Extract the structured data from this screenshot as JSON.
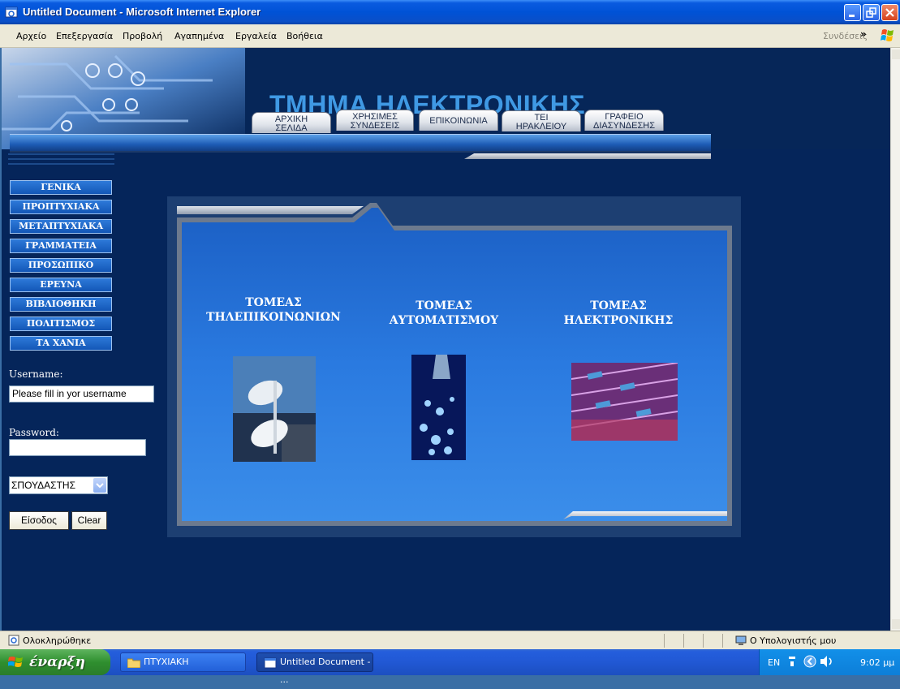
{
  "window": {
    "title": "Untitled Document - Microsoft Internet Explorer"
  },
  "menubar": {
    "items": [
      "Αρχείο",
      "Επεξεργασία",
      "Προβολή",
      "Αγαπημένα",
      "Εργαλεία",
      "Βοήθεια"
    ],
    "links_label": "Συνδέσεις"
  },
  "site": {
    "title": "ΤΜΗΜΑ ΗΛΕΚΤΡΟΝΙΚΗΣ",
    "nav_tabs": [
      {
        "line1": "ΑΡΧΙΚΗ",
        "line2": "ΣΕΛΙΔΑ"
      },
      {
        "line1": "ΧΡΗΣΙΜΕΣ",
        "line2": "ΣΥΝΔΕΣΕΙΣ"
      },
      {
        "line1": "ΕΠΙΚΟΙΝΩΝΙΑ",
        "line2": ""
      },
      {
        "line1": "ΤΕΙ",
        "line2": "ΗΡΑΚΛΕΙΟΥ"
      },
      {
        "line1": "ΓΡΑΦΕΙΟ",
        "line2": "ΔΙΑΣΥΝΔΕΣΗΣ"
      }
    ],
    "side_menu": [
      "ΓΕΝΙΚΑ",
      "ΠΡΟΠΤΥΧΙΑΚΑ",
      "ΜΕΤΑΠΤΥΧΙΑΚΑ",
      "ΓΡΑΜΜΑΤΕΙΑ",
      "ΠΡΟΣΩΠΙΚΟ",
      "ΕΡΕΥΝΑ",
      "ΒΙΒΛΙΟΘΗΚΗ",
      "ΠΟΛΙΤΙΣΜΟΣ",
      "ΤΑ ΧΑΝΙΑ"
    ],
    "login": {
      "username_label": "Username:",
      "username_value": "Please fill in yor username",
      "password_label": "Password:",
      "password_value": "",
      "role_selected": "ΣΠΟΥΔΑΣΤΗΣ",
      "submit_label": "Είσοδος",
      "clear_label": "Clear"
    },
    "departments": [
      {
        "line1": "ΤΟΜΕΑΣ",
        "line2": "ΤΗΛΕΠΙΚΟΙΝΩΝΙΩΝ",
        "image": "satellite-dish"
      },
      {
        "line1": "ΤΟΜΕΑΣ",
        "line2": "ΑΥΤΟΜΑΤΙΣΜΟΥ",
        "image": "optical-fiber"
      },
      {
        "line1": "ΤΟΜΕΑΣ",
        "line2": "ΗΛΕΚΤΡΟΝΙΚΗΣ",
        "image": "resistors"
      }
    ]
  },
  "statusbar": {
    "status": "Ολοκληρώθηκε",
    "zone": "Ο Υπολογιστής μου"
  },
  "taskbar": {
    "start_label": "έναρξη",
    "items": [
      "ΠΤΥΧΙΑΚΗ",
      "Untitled Document - ..."
    ],
    "language": "EN",
    "clock": "9:02 μμ"
  }
}
